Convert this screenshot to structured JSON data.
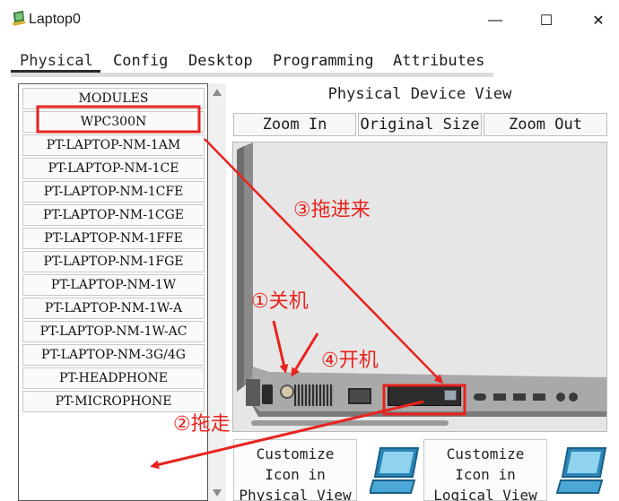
{
  "window": {
    "title": "Laptop0",
    "controls": {
      "minimize": "—",
      "maximize": "☐",
      "close": "✕"
    }
  },
  "tabs": [
    {
      "label": "Physical",
      "active": true
    },
    {
      "label": "Config",
      "active": false
    },
    {
      "label": "Desktop",
      "active": false
    },
    {
      "label": "Programming",
      "active": false
    },
    {
      "label": "Attributes",
      "active": false
    }
  ],
  "modules": {
    "header": "MODULES",
    "items": [
      "WPC300N",
      "PT-LAPTOP-NM-1AM",
      "PT-LAPTOP-NM-1CE",
      "PT-LAPTOP-NM-1CFE",
      "PT-LAPTOP-NM-1CGE",
      "PT-LAPTOP-NM-1FFE",
      "PT-LAPTOP-NM-1FGE",
      "PT-LAPTOP-NM-1W",
      "PT-LAPTOP-NM-1W-A",
      "PT-LAPTOP-NM-1W-AC",
      "PT-LAPTOP-NM-3G/4G",
      "PT-HEADPHONE",
      "PT-MICROPHONE"
    ]
  },
  "device_view": {
    "title": "Physical Device View",
    "zoom_in": "Zoom In",
    "original_size": "Original Size",
    "zoom_out": "Zoom Out"
  },
  "customize": {
    "physical": [
      "Customize",
      "Icon in",
      "Physical View"
    ],
    "logical": [
      "Customize",
      "Icon in",
      "Logical View"
    ]
  },
  "annotations": {
    "step1": "①关机",
    "step2": "②拖走",
    "step3": "③拖进来",
    "step4": "④开机"
  },
  "colors": {
    "annotation_red": "#e8231e",
    "laptop_body": "#8f8f8f",
    "view_background": "#e6e6e6"
  },
  "icons": [
    "laptop-app-icon",
    "minimize-icon",
    "maximize-icon",
    "close-icon",
    "scroll-up-icon",
    "scroll-down-icon",
    "laptop-icon"
  ]
}
